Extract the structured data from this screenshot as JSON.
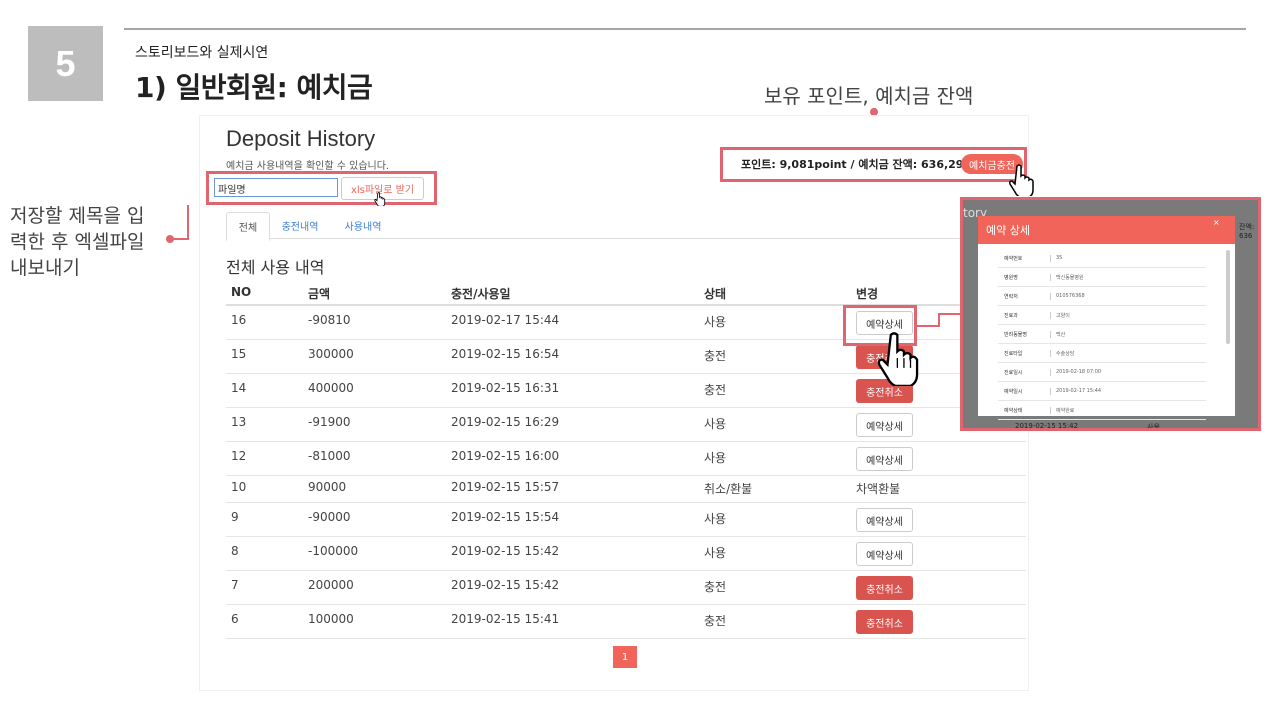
{
  "slide": {
    "number": "5",
    "subtitle": "스토리보드와 실제시연",
    "title": "1) 일반회원: 예치금"
  },
  "annotations": {
    "top_right": "보유 포인트, 예치금 잔액",
    "left_line1": "저장할 제목을 입",
    "left_line2": "력한 후 엑셀파일",
    "left_line3": "내보내기"
  },
  "page": {
    "title": "Deposit History",
    "description": "예치금 사용내역을 확인할 수 있습니다.",
    "balance_text": "포인트: 9,081point /  예치금 잔액: 636,290원",
    "charge_button": "예치금충전",
    "file_input_value": "파일명",
    "xls_button": "xls파일로 받기",
    "tabs": [
      "전체",
      "충전내역",
      "사용내역"
    ],
    "section_title": "전체 사용 내역",
    "table_headers": [
      "NO",
      "금액",
      "충전/사용일",
      "상태",
      "변경"
    ],
    "rows": [
      {
        "no": "16",
        "amount": "-90810",
        "date": "2019-02-17 15:44",
        "status": "사용",
        "action": "예약상세",
        "action_type": "detail"
      },
      {
        "no": "15",
        "amount": "300000",
        "date": "2019-02-15 16:54",
        "status": "충전",
        "action": "충전취소",
        "action_type": "cancel"
      },
      {
        "no": "14",
        "amount": "400000",
        "date": "2019-02-15 16:31",
        "status": "충전",
        "action": "충전취소",
        "action_type": "cancel"
      },
      {
        "no": "13",
        "amount": "-91900",
        "date": "2019-02-15 16:29",
        "status": "사용",
        "action": "예약상세",
        "action_type": "detail"
      },
      {
        "no": "12",
        "amount": "-81000",
        "date": "2019-02-15 16:00",
        "status": "사용",
        "action": "예약상세",
        "action_type": "detail"
      },
      {
        "no": "10",
        "amount": "90000",
        "date": "2019-02-15 15:57",
        "status": "취소/환불",
        "action": "차액환불",
        "action_type": "text"
      },
      {
        "no": "9",
        "amount": "-90000",
        "date": "2019-02-15 15:54",
        "status": "사용",
        "action": "예약상세",
        "action_type": "detail"
      },
      {
        "no": "8",
        "amount": "-100000",
        "date": "2019-02-15 15:42",
        "status": "사용",
        "action": "예약상세",
        "action_type": "detail"
      },
      {
        "no": "7",
        "amount": "200000",
        "date": "2019-02-15 15:42",
        "status": "충전",
        "action": "충전취소",
        "action_type": "cancel"
      },
      {
        "no": "6",
        "amount": "100000",
        "date": "2019-02-15 15:41",
        "status": "충전",
        "action": "충전취소",
        "action_type": "cancel"
      }
    ],
    "pagination": [
      "1"
    ]
  },
  "modal": {
    "bg_title_fragment": "tory",
    "bg_row_date": "2019-02-15 15:42",
    "bg_row_status": "사용",
    "bg_right_fragment": "잔액: 636",
    "title": "예약 상세",
    "close_symbol": "×",
    "fields": [
      {
        "label": "예약번호",
        "value": "35"
      },
      {
        "label": "병원명",
        "value": "백신동물병원"
      },
      {
        "label": "연락처",
        "value": "010576368"
      },
      {
        "label": "진료과",
        "value": "고양이"
      },
      {
        "label": "반려동물명",
        "value": "백산"
      },
      {
        "label": "진료타입",
        "value": "수술상담"
      },
      {
        "label": "진료일시",
        "value": "2019-02-18 07:00"
      },
      {
        "label": "예약일시",
        "value": "2019-02-17 15:44"
      },
      {
        "label": "예약상태",
        "value": "예약완료"
      }
    ]
  },
  "colors": {
    "accent": "#f0645a",
    "annotation": "#e0656f",
    "danger": "#d9534f",
    "link": "#3a7bd5"
  }
}
